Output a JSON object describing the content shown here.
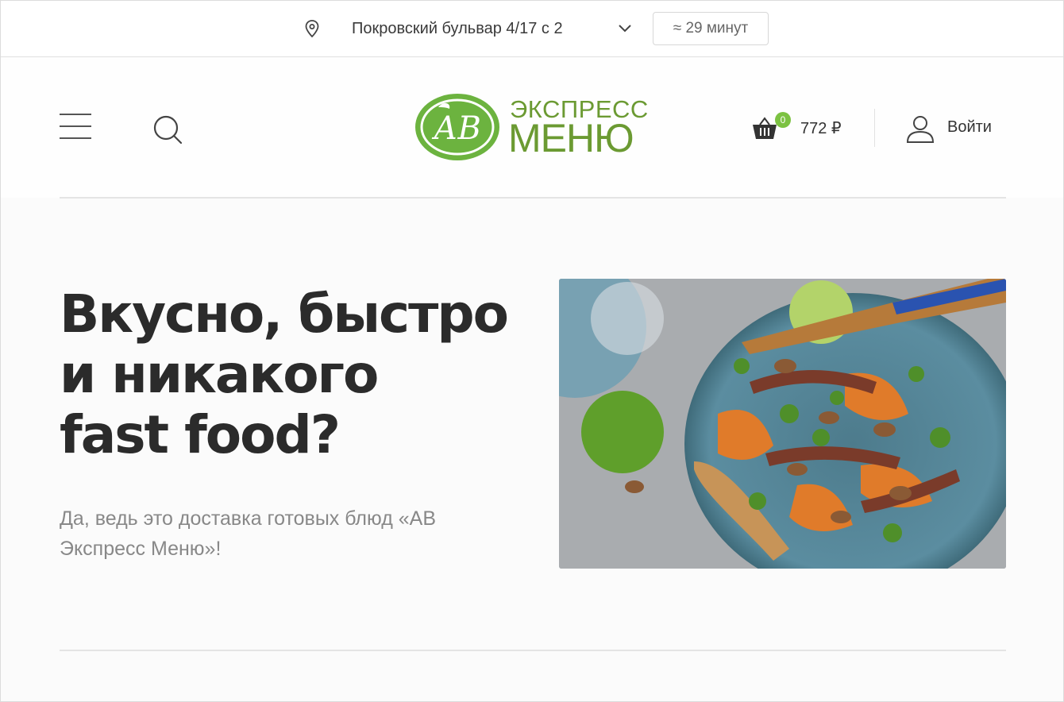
{
  "topbar": {
    "address": "Покровский бульвар 4/17 с 2",
    "delivery_time": "≈ 29 минут"
  },
  "header": {
    "logo": {
      "monogram": "АВ",
      "line1": "ЭКСПРЕСС",
      "line2": "МЕНЮ"
    },
    "cart": {
      "count": "0",
      "sum": "772 ₽"
    },
    "login_label": "Войти"
  },
  "hero": {
    "title": "Вкусно, быстро\nи никакого\nfast food?",
    "subtitle": "Да, ведь это доставка готовых блюд «АВ Экспресс Меню»!"
  },
  "colors": {
    "brand_green": "#6b9a32",
    "badge_green": "#7cc242",
    "text_dark": "#2b2b2b",
    "text_muted": "#888888"
  },
  "icons": [
    "location-pin-icon",
    "chevron-down-icon",
    "menu-icon",
    "search-icon",
    "cart-icon",
    "user-icon"
  ]
}
